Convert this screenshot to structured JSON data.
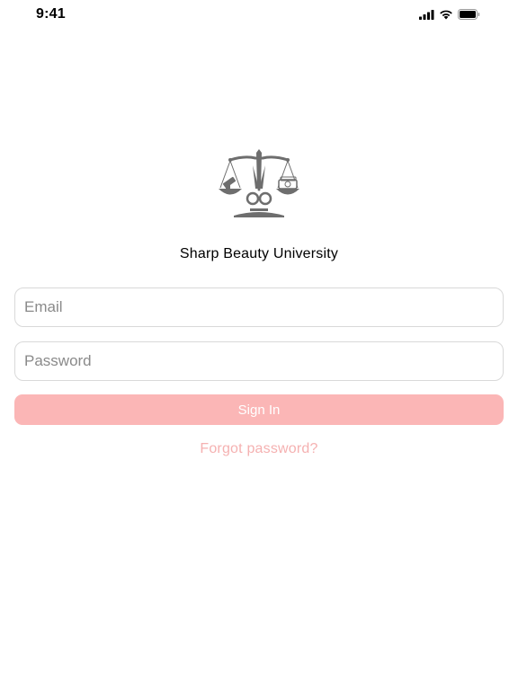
{
  "status_bar": {
    "time": "9:41",
    "icons": [
      "cellular-signal-icon",
      "wifi-icon",
      "battery-icon"
    ]
  },
  "logo": {
    "icon": "scales-of-justice-scissors-logo"
  },
  "app": {
    "title": "Sharp Beauty University"
  },
  "form": {
    "email_placeholder": "Email",
    "email_value": "",
    "password_placeholder": "Password",
    "password_value": "",
    "sign_in_label": "Sign In",
    "forgot_password_label": "Forgot password?"
  },
  "colors": {
    "accent": "#fbb6b6",
    "link": "#f5b1b1",
    "logo_gray": "#6e6e6e",
    "border": "#d9d9d9"
  }
}
